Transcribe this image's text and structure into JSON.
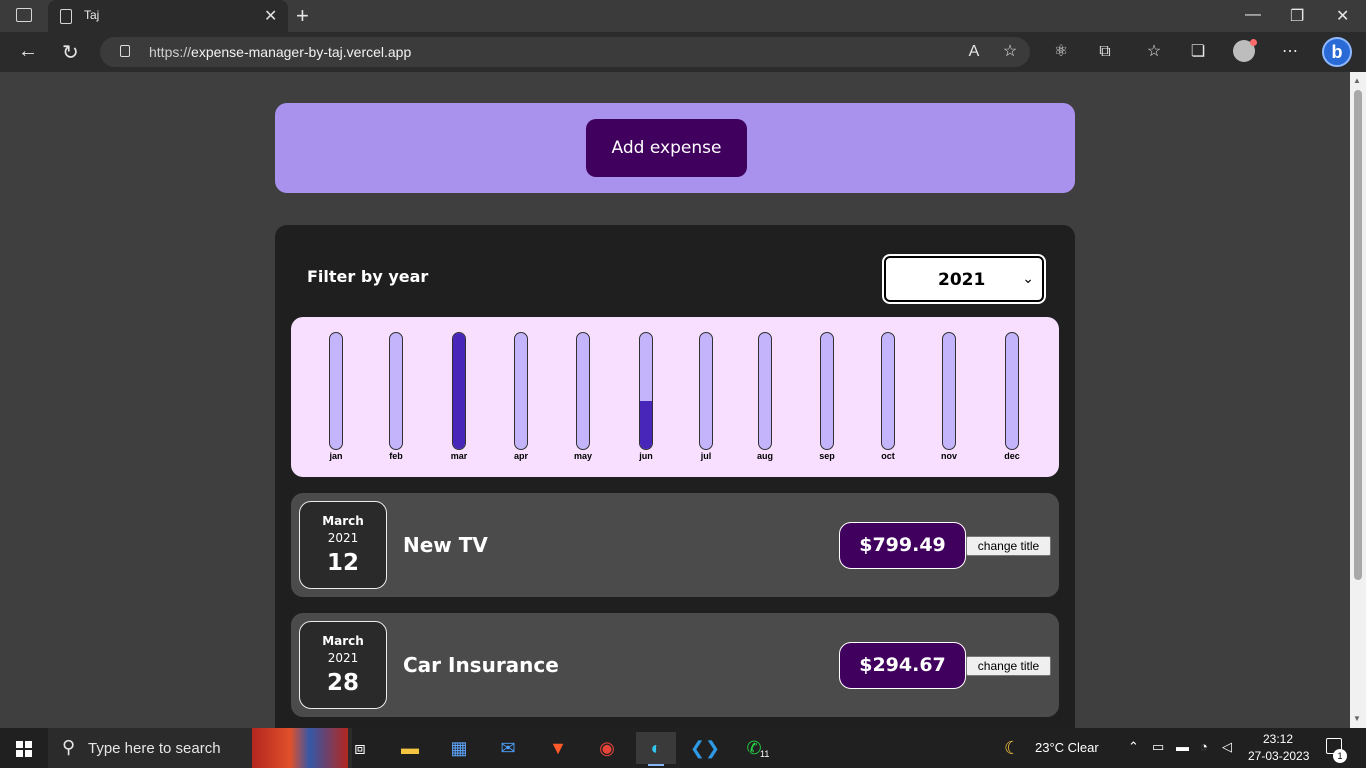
{
  "browser": {
    "tab_title": "Taj",
    "url_prefix": "https://",
    "url_host": "expense-manager-by-taj.vercel.app"
  },
  "page": {
    "add_expense_label": "Add expense",
    "filter_label": "Filter by year",
    "selected_year": "2021",
    "chart_data": {
      "type": "bar",
      "categories": [
        "jan",
        "feb",
        "mar",
        "apr",
        "may",
        "jun",
        "jul",
        "aug",
        "sep",
        "oct",
        "nov",
        "dec"
      ],
      "values": [
        0,
        0,
        1.0,
        0,
        0,
        0.41,
        0,
        0,
        0,
        0,
        0,
        0
      ],
      "ylim": [
        0,
        1
      ]
    },
    "expenses": [
      {
        "month": "March",
        "year": "2021",
        "day": "12",
        "title": "New TV",
        "amount": "$799.49",
        "change_label": "change title"
      },
      {
        "month": "March",
        "year": "2021",
        "day": "28",
        "title": "Car Insurance",
        "amount": "$294.67",
        "change_label": "change title"
      }
    ]
  },
  "taskbar": {
    "search_placeholder": "Type here to search",
    "weather": "23°C  Clear",
    "time": "23:12",
    "date": "27-03-2023",
    "notification_count": "1",
    "whatsapp_badge": "11"
  }
}
